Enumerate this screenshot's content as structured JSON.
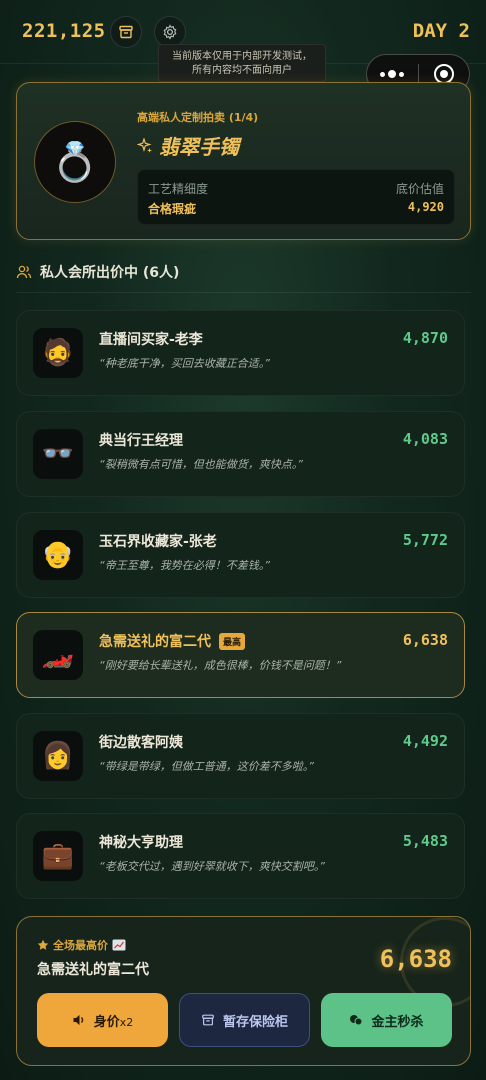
{
  "header": {
    "money": "221,125",
    "day": "DAY 2",
    "tooltip_line1": "当前版本仅用于内部开发测试，",
    "tooltip_line2": "所有内容均不面向用户"
  },
  "item": {
    "auction_tag": "高端私人定制拍卖 (1/4)",
    "name": "翡翠手镯",
    "craft_label": "工艺精细度",
    "craft_value": "合格瑕疵",
    "base_label": "底价估值",
    "base_value": "4,920"
  },
  "section": {
    "title": "私人会所出价中 (6人)"
  },
  "bidders": [
    {
      "name": "直播间买家-老李",
      "quote": "“种老底干净，买回去收藏正合适。”",
      "price": "4,870",
      "avatar": "🧔"
    },
    {
      "name": "典当行王经理",
      "quote": "“裂稍微有点可惜，但也能做货，爽快点。”",
      "price": "4,083",
      "avatar": "👓"
    },
    {
      "name": "玉石界收藏家-张老",
      "quote": "“帝王至尊，我势在必得！不差钱。”",
      "price": "5,772",
      "avatar": "👴"
    },
    {
      "name": "急需送礼的富二代",
      "badge": "最高",
      "quote": "“刚好要给长辈送礼，成色很棒，价钱不是问题！”",
      "price": "6,638",
      "avatar": "🏎️"
    },
    {
      "name": "街边散客阿姨",
      "quote": "“带绿是带绿，但做工普通，这价差不多啦。”",
      "price": "4,492",
      "avatar": "👩"
    },
    {
      "name": "神秘大亨助理",
      "quote": "“老板交代过，遇到好翠就收下，爽快交割吧。”",
      "price": "5,483",
      "avatar": "💼"
    }
  ],
  "bottom": {
    "label": "全场最高价",
    "leader_name": "急需送礼的富二代",
    "leader_price": "6,638",
    "btn_boost": "身价",
    "btn_boost_mult": "x2",
    "btn_safe": "暂存保险柜",
    "btn_buy": "金主秒杀"
  },
  "colors": {
    "gold": "#f0c15a",
    "green": "#5fca8c",
    "bg": "#12281e"
  }
}
